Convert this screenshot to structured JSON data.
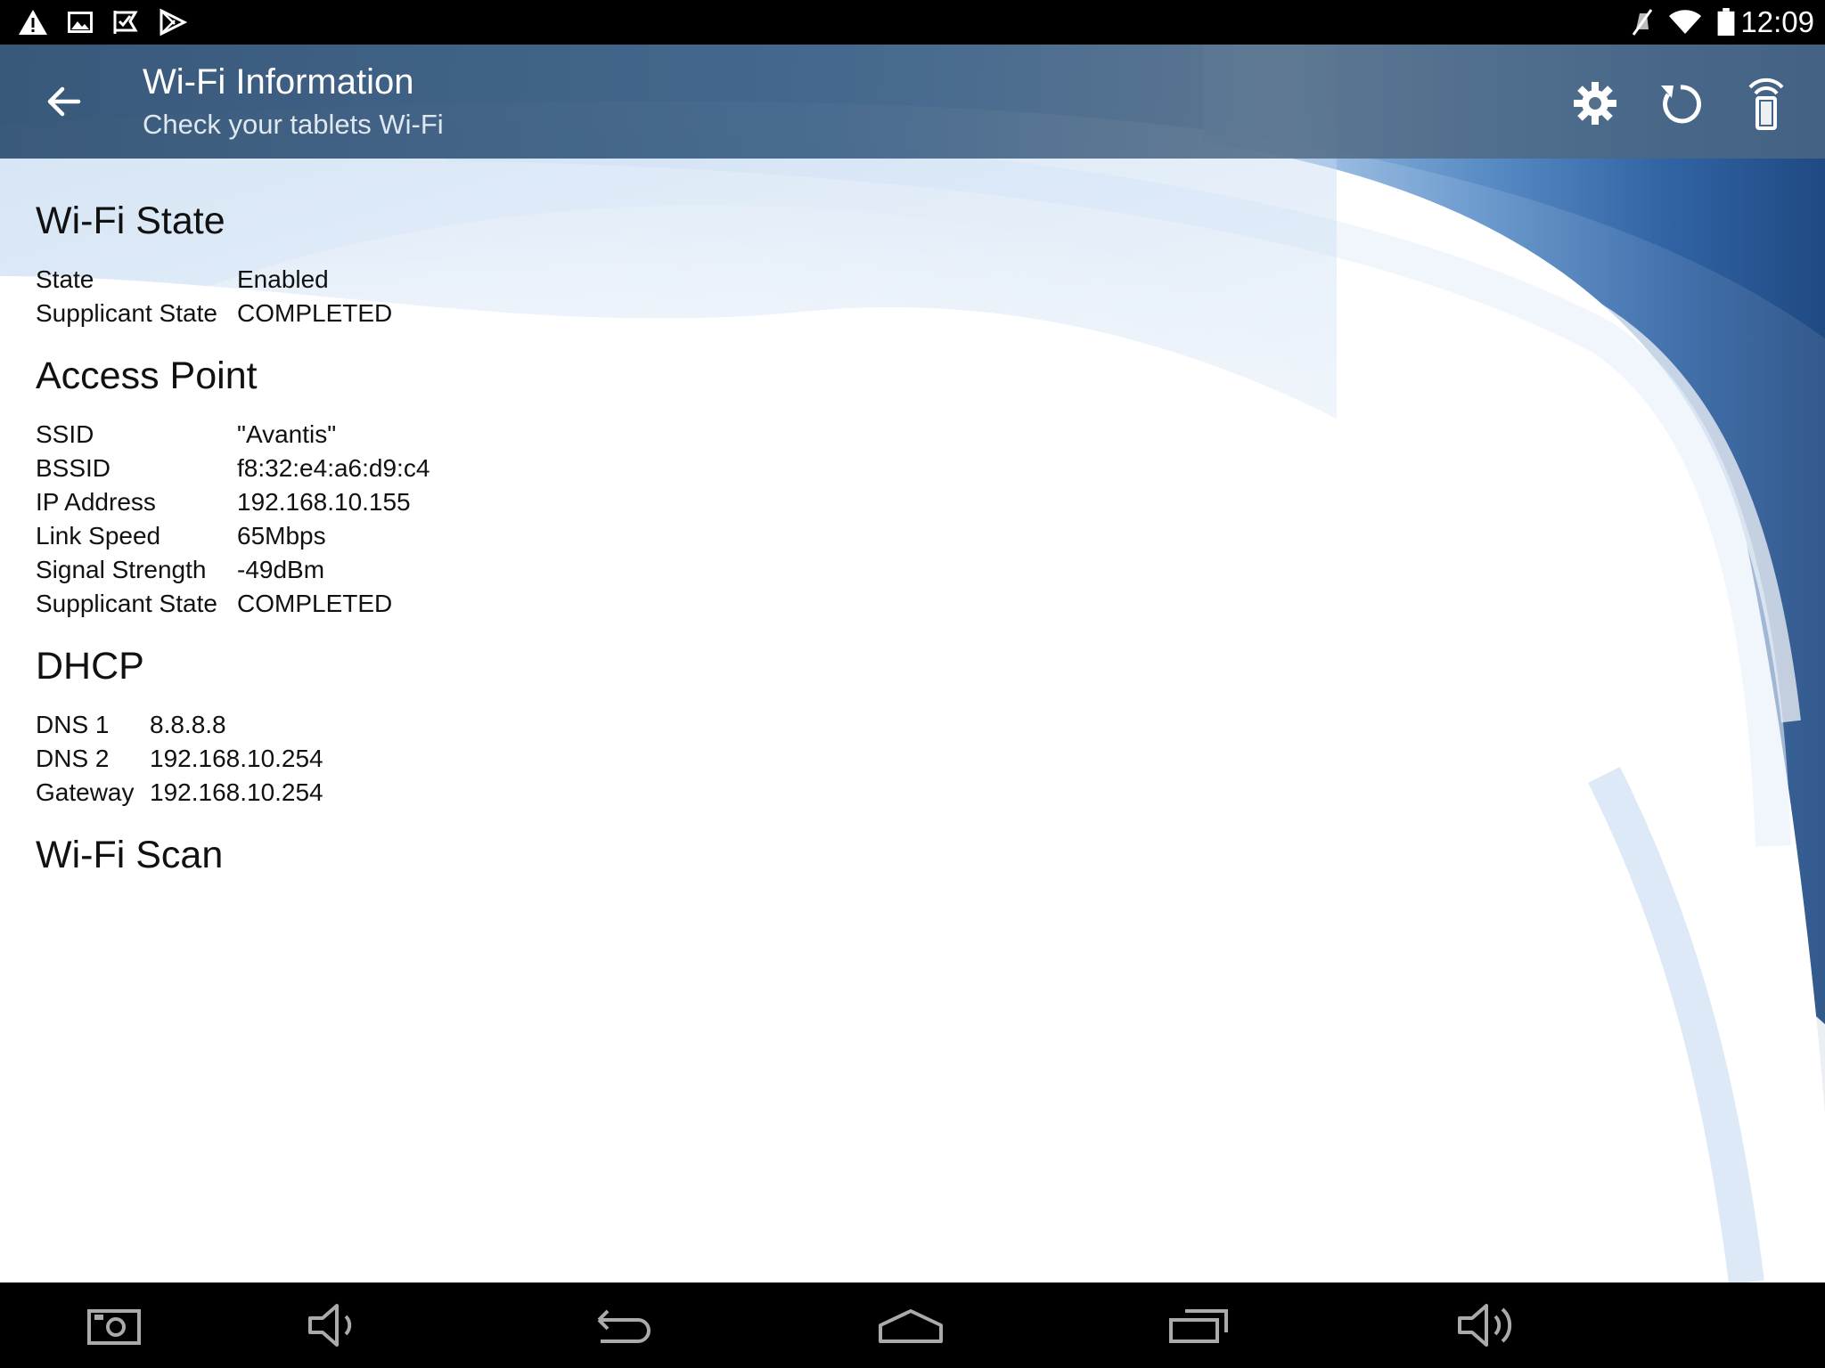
{
  "status_bar": {
    "time": "12:09",
    "left_icons": [
      "warning-icon",
      "image-icon",
      "check-flag-icon",
      "play-store-icon"
    ],
    "right_icons": [
      "muted-icon",
      "wifi-icon",
      "battery-icon"
    ]
  },
  "action_bar": {
    "title": "Wi-Fi Information",
    "subtitle": "Check your tablets Wi-Fi",
    "actions": [
      "settings-icon",
      "refresh-icon",
      "signal-tower-icon"
    ]
  },
  "sections": {
    "wifi_state": {
      "title": "Wi-Fi State",
      "rows": [
        {
          "key": "State",
          "value": "Enabled"
        },
        {
          "key": "Supplicant State",
          "value": "COMPLETED"
        }
      ]
    },
    "access_point": {
      "title": "Access Point",
      "rows": [
        {
          "key": "SSID",
          "value": "\"Avantis\""
        },
        {
          "key": "BSSID",
          "value": "f8:32:e4:a6:d9:c4"
        },
        {
          "key": "IP Address",
          "value": "192.168.10.155"
        },
        {
          "key": "Link Speed",
          "value": "65Mbps"
        },
        {
          "key": "Signal Strength",
          "value": "-49dBm"
        },
        {
          "key": "Supplicant State",
          "value": "COMPLETED"
        }
      ]
    },
    "dhcp": {
      "title": "DHCP",
      "rows": [
        {
          "key": "DNS 1",
          "value": "8.8.8.8"
        },
        {
          "key": "DNS 2",
          "value": "192.168.10.254"
        },
        {
          "key": "Gateway",
          "value": "192.168.10.254"
        }
      ]
    },
    "wifi_scan": {
      "title": "Wi-Fi Scan"
    }
  },
  "nav_bar": {
    "buttons": [
      "screenshot-icon",
      "volume-down-icon",
      "back-icon",
      "home-icon",
      "recents-icon",
      "volume-up-icon"
    ]
  },
  "colors": {
    "status_bar": "#000000",
    "action_bar": "#3e6288",
    "swoosh_dark": "#2c5b94",
    "swoosh_light": "#cfe0f3",
    "text": "#111111"
  }
}
